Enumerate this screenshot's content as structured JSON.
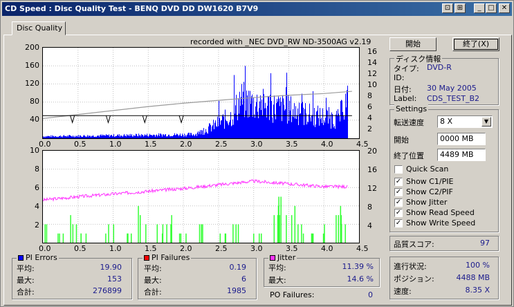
{
  "window": {
    "title": "CD Speed : Disc Quality Test - BENQ    DVD DD DW1620    B7V9",
    "btn_a": "⊡",
    "btn_b": "⊞",
    "btn_min": "_",
    "btn_max": "□",
    "btn_close": "✕"
  },
  "tab": "Disc Quality",
  "recorded_with": "recorded with _NEC        DVD_RW ND-3500AG v2.19",
  "top_chart": {
    "y_left": [
      "200",
      "160",
      "120",
      "80",
      "40"
    ],
    "y_right": [
      "16",
      "14",
      "12",
      "10",
      "8",
      "6",
      "4",
      "2"
    ],
    "x": [
      "0.0",
      "0.5",
      "1.0",
      "1.5",
      "2.0",
      "2.5",
      "3.0",
      "3.5",
      "4.0",
      "4.5"
    ]
  },
  "bottom_chart": {
    "y_left": [
      "10",
      "8",
      "6",
      "4",
      "2"
    ],
    "y_right": [
      "20",
      "16",
      "12",
      "8",
      "4"
    ],
    "x": [
      "0.0",
      "0.5",
      "1.0",
      "1.5",
      "2.0",
      "2.5",
      "3.0",
      "3.5",
      "4.0",
      "4.5"
    ]
  },
  "chart_data": [
    {
      "type": "bar",
      "series": [
        {
          "name": "PI Errors",
          "x": [
            0,
            2.15,
            2.3,
            2.5,
            2.7,
            2.8,
            3.0,
            3.3,
            3.5,
            3.8,
            4.0,
            4.2,
            4.35
          ],
          "y": [
            5,
            10,
            20,
            40,
            60,
            100,
            90,
            80,
            75,
            60,
            55,
            50,
            110
          ]
        },
        {
          "name": "Read Speed",
          "x": [
            0,
            0.5,
            1.0,
            1.5,
            2.0,
            2.5,
            3.0,
            3.5,
            4.0,
            4.4
          ],
          "y": [
            3.5,
            4.2,
            4.9,
            5.6,
            6.2,
            6.7,
            7.2,
            7.6,
            7.9,
            8.3
          ]
        },
        {
          "name": "Write Speed",
          "x": [
            0,
            4.4
          ],
          "y": [
            4,
            4
          ]
        }
      ],
      "xlim": [
        0,
        4.5
      ],
      "ylim": [
        0,
        200
      ],
      "y2lim": [
        0,
        16
      ],
      "color_pi": "#0000ff",
      "color_speed": "#9a9a9a",
      "color_write": "#000000"
    },
    {
      "type": "line",
      "series": [
        {
          "name": "Jitter",
          "x": [
            0,
            0.5,
            1.0,
            1.5,
            2.0,
            2.5,
            3.0,
            3.5,
            4.0,
            4.4
          ],
          "y": [
            9.3,
            10.0,
            10.6,
            11.2,
            11.8,
            12.6,
            13.4,
            12.8,
            12.2,
            12.2
          ]
        },
        {
          "name": "PI Failures",
          "x": [
            0.0,
            0.25,
            0.45,
            0.6,
            0.95,
            1.2,
            1.4,
            1.65,
            1.8,
            2.0,
            2.25,
            2.55,
            2.75,
            3.05,
            3.3,
            3.42,
            3.52,
            3.65,
            3.8,
            4.05,
            4.2,
            4.3
          ],
          "y": [
            2,
            1,
            3,
            1,
            2,
            1,
            4,
            2,
            3,
            1,
            2,
            1,
            2,
            1,
            3,
            5,
            4,
            2,
            1,
            2,
            4,
            3
          ]
        }
      ],
      "xlim": [
        0,
        4.5
      ],
      "ylim": [
        0,
        10
      ],
      "y2lim": [
        0,
        20
      ],
      "color_jitter": "#ff33ff",
      "color_pif": "#33ff33"
    }
  ],
  "stats": {
    "pie": {
      "title": "PI Errors",
      "avg_label": "平均:",
      "avg": "19.90",
      "max_label": "最大:",
      "max": "153",
      "total_label": "合計:",
      "total": "276899",
      "color": "#0000ff"
    },
    "pif": {
      "title": "PI Failures",
      "avg_label": "平均:",
      "avg": "0.19",
      "max_label": "最大:",
      "max": "6",
      "total_label": "合計:",
      "total": "1985",
      "color": "#ff0000"
    },
    "jitter": {
      "title": "Jitter",
      "avg_label": "平均:",
      "avg": "11.39 %",
      "max_label": "最大:",
      "max": "14.6 %",
      "color": "#ff33ff"
    },
    "po_label": "PO Failures:",
    "po": "0"
  },
  "buttons": {
    "start": "開始",
    "stop": "終了(X)"
  },
  "disc_info": {
    "title": "ディスク情報",
    "type_label": "タイプ:",
    "type": "DVD-R",
    "id_label": "ID:",
    "id": "",
    "date_label": "日付:",
    "date": "30 May 2005",
    "label_label": "Label:",
    "label": "CDS_TEST_B2"
  },
  "settings": {
    "title": "Settings",
    "speed_label": "転送速度",
    "speed": "8 X",
    "start_label": "開始",
    "start": "0000 MB",
    "end_label": "終了位置",
    "end": "4489 MB",
    "quick_scan": "Quick Scan",
    "show_c1": "Show C1/PIE",
    "show_c2": "Show C2/PIF",
    "show_jitter": "Show Jitter",
    "show_read": "Show Read Speed",
    "show_write": "Show Write Speed",
    "check": "✓"
  },
  "quality": {
    "label": "品質スコア:",
    "value": "97"
  },
  "progress": {
    "progress_label": "進行状況:",
    "progress": "100 %",
    "position_label": "ポジション:",
    "position": "4488 MB",
    "speed_label": "速度:",
    "speed": "8.35 X"
  }
}
